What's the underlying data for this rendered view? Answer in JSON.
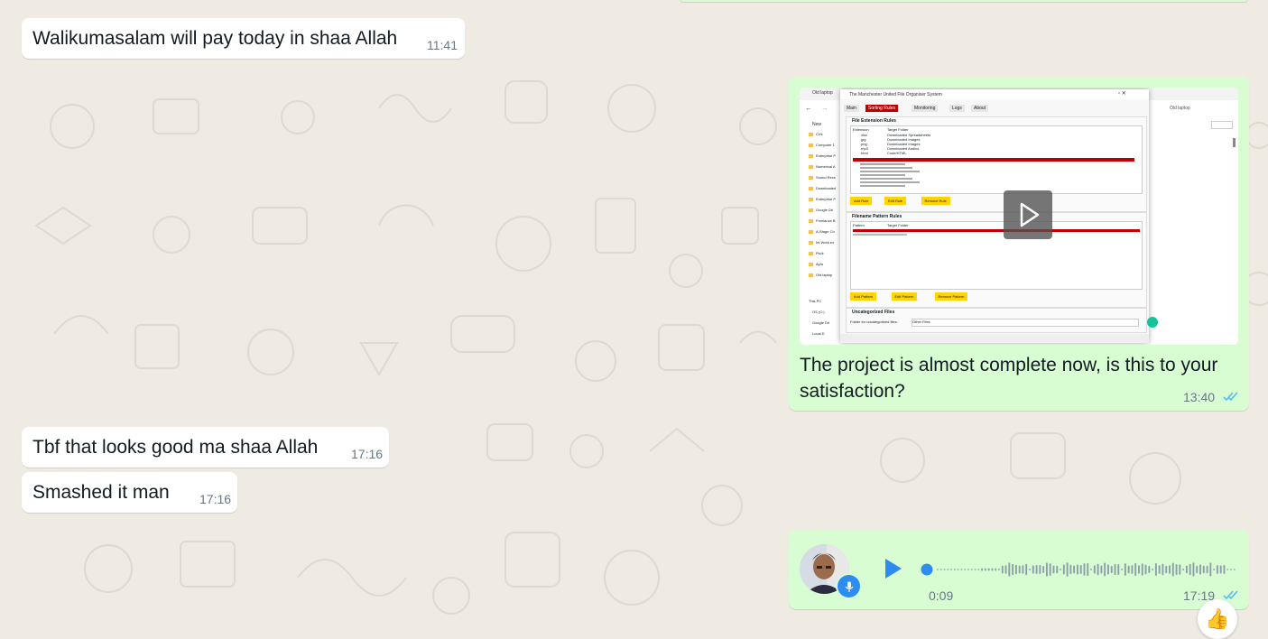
{
  "messages": [
    {
      "type": "text",
      "direction": "incoming",
      "text": "Walikumasalam will pay today in shaa Allah",
      "time": "11:41"
    },
    {
      "type": "video",
      "direction": "outgoing",
      "caption_line1": "The project is almost complete now, is this to your",
      "caption_line2": "satisfaction?",
      "time": "13:40",
      "status": "read",
      "thumbnail": {
        "window_title": "The Manchester United File Organiser System",
        "tabs": [
          "Main",
          "Sorting Rules",
          "Monitoring",
          "Logs",
          "About"
        ],
        "active_tab": "Sorting Rules",
        "section_extension": "File Extension Rules",
        "col_extension": "Extension",
        "col_target": "Target Folder",
        "ext_rules": [
          [
            ".xlsx",
            "Downloaded Spreadsheets"
          ],
          [
            ".jpg",
            "Downloaded Images"
          ],
          [
            ".png",
            "Downloaded Images"
          ],
          [
            ".mp3",
            "Downloaded Audios"
          ],
          [
            ".html",
            "Code/HTML"
          ]
        ],
        "buttons_ext": [
          "Add Rule",
          "Edit Rule",
          "Remove Rule"
        ],
        "section_pattern": "Filename Pattern Rules",
        "col_pattern": "Pattern",
        "buttons_pattern": [
          "Add Pattern",
          "Edit Pattern",
          "Remove Pattern"
        ],
        "section_uncategorized": "Uncategorized Files",
        "uncategorized_label": "Folder for uncategorized files:",
        "uncategorized_value": "Other Files",
        "explorer_title": "Old laptop",
        "explorer_new": "New",
        "explorer_items": [
          "CVs",
          "Computer 1",
          "Enterprise P",
          "Numerical A",
          "Sound Recs",
          "Downloaded",
          "Enterprise P",
          "Google Dri",
          "Freelance B",
          "A-Stage Ch",
          "Int Work ex",
          "Pic/k",
          "Aplu",
          "Old laptop"
        ],
        "explorer_tree": [
          "This PC",
          "OS (C:)",
          "Google Dri",
          "Local D"
        ]
      },
      "colors": {
        "accent_red": "#c00000",
        "button_yellow": "#ffd400"
      }
    },
    {
      "type": "text",
      "direction": "incoming",
      "text": "Tbf that looks good ma shaa Allah",
      "time": "17:16"
    },
    {
      "type": "text",
      "direction": "incoming",
      "text": "Smashed it man",
      "time": "17:16"
    },
    {
      "type": "voice",
      "direction": "outgoing",
      "duration": "0:09",
      "time": "17:19",
      "status": "read",
      "reaction": "👍",
      "progress": 0
    }
  ],
  "colors": {
    "chat_background": "#efeae2",
    "incoming_bubble": "#ffffff",
    "outgoing_bubble": "#d9fdd3",
    "read_ticks": "#53bdeb",
    "voice_accent": "#2d8cf0",
    "timestamp": "#667781"
  }
}
